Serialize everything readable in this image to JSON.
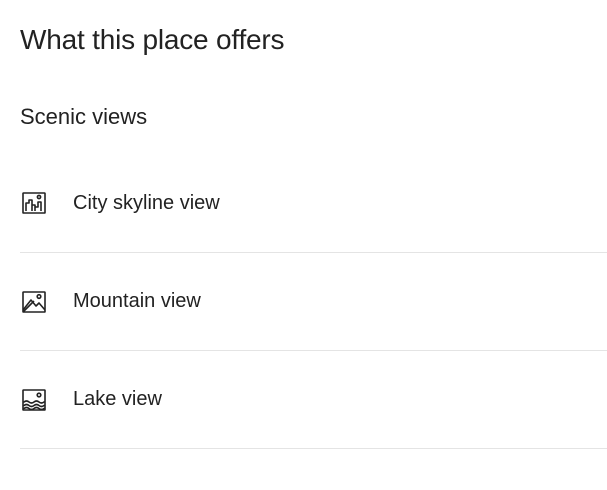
{
  "page": {
    "title": "What this place offers"
  },
  "section": {
    "title": "Scenic views"
  },
  "amenities": [
    {
      "label": "City skyline view",
      "icon": "city-skyline-icon"
    },
    {
      "label": "Mountain view",
      "icon": "mountain-view-icon"
    },
    {
      "label": "Lake view",
      "icon": "lake-view-icon"
    }
  ],
  "colors": {
    "text": "#222222",
    "divider": "#e4e4e4",
    "background": "#ffffff"
  }
}
